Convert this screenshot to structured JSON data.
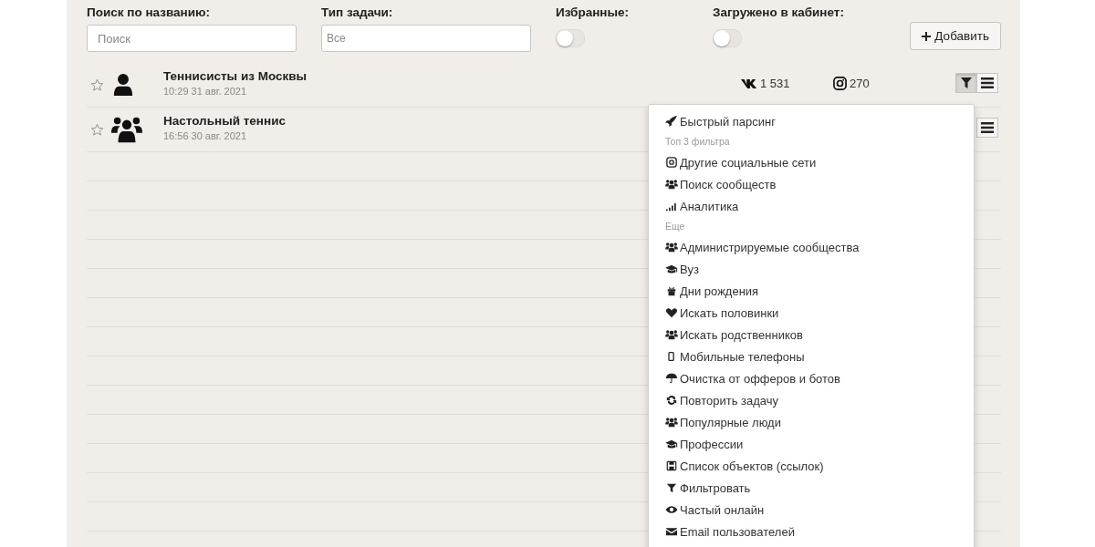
{
  "filters": {
    "search": {
      "label": "Поиск по названию:",
      "placeholder": "Поиск"
    },
    "task_type": {
      "label": "Тип задачи:",
      "placeholder": "Все"
    },
    "favorites": {
      "label": "Избранные:",
      "on": false
    },
    "loaded": {
      "label": "Загружено в кабинет:",
      "on": false
    },
    "add_button": "Добавить"
  },
  "tasks": [
    {
      "title": "Теннисисты из Москвы",
      "time": "10:29 31 авг. 2021",
      "kind": "person",
      "favorite": false,
      "vk_count": "1 531",
      "instagram_count": "270",
      "filter_open": true
    },
    {
      "title": "Настольный теннис",
      "time": "16:56 30 авг. 2021",
      "kind": "group",
      "favorite": false
    }
  ],
  "menu": [
    {
      "kind": "item",
      "label": "Быстрый парсинг"
    },
    {
      "kind": "header",
      "label": "Топ 3 фильтра"
    },
    {
      "kind": "item",
      "label": "Другие социальные сети"
    },
    {
      "kind": "item",
      "label": "Поиск сообществ"
    },
    {
      "kind": "item",
      "label": "Аналитика"
    },
    {
      "kind": "header",
      "label": "Еще"
    },
    {
      "kind": "item",
      "label": "Администрируемые сообщества"
    },
    {
      "kind": "item",
      "label": "Вуз"
    },
    {
      "kind": "item",
      "label": "Дни рождения"
    },
    {
      "kind": "item",
      "label": "Искать половинки"
    },
    {
      "kind": "item",
      "label": "Искать родственников"
    },
    {
      "kind": "item",
      "label": "Мобильные телефоны"
    },
    {
      "kind": "item",
      "label": "Очистка от офферов и ботов"
    },
    {
      "kind": "item",
      "label": "Повторить задачу"
    },
    {
      "kind": "item",
      "label": "Популярные люди"
    },
    {
      "kind": "item",
      "label": "Профессии"
    },
    {
      "kind": "item",
      "label": "Список объектов (ссылок)"
    },
    {
      "kind": "item",
      "label": "Фильтровать"
    },
    {
      "kind": "item",
      "label": "Частый онлайн"
    },
    {
      "kind": "item",
      "label": "Email пользователей"
    }
  ]
}
